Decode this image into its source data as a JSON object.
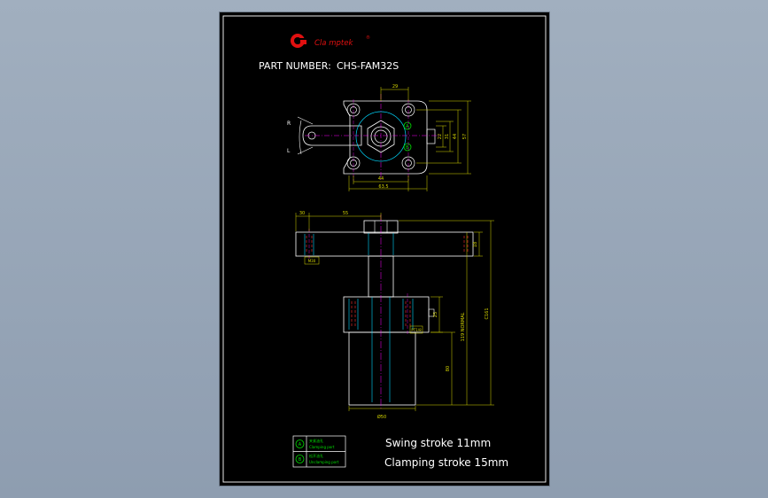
{
  "brand": {
    "name": "Cla mptek",
    "reg_mark": "®",
    "logo_color": "#e01010"
  },
  "drawing": {
    "part_number_label": "PART NUMBER:",
    "part_number": "CHS-FAM32S",
    "swing_stroke": "Swing stroke 11mm",
    "clamping_stroke": "Clamping stroke 15mm"
  },
  "labels": {
    "rotation_right": "R",
    "rotation_left": "L",
    "port_a": "A",
    "port_b": "B"
  },
  "dimensions": {
    "top_width": "29",
    "bolt_spacing_44": "44",
    "overall_width": "63.5",
    "side_22": "22",
    "side_31": "31",
    "side_44": "44",
    "side_57": "57",
    "arm_offset": "30",
    "arm_length": "55",
    "arm_thickness": "18",
    "bolt_hole": "M30",
    "body_flange": "25",
    "port_size": "PT1/8",
    "clamp_height": "119 NORMAL",
    "overall_height": "C161",
    "body_length": "80",
    "body_diameter": "Ø50"
  },
  "legend": {
    "items": [
      {
        "symbol": "A",
        "title": "夹紧油孔",
        "desc": "Clamping port"
      },
      {
        "symbol": "B",
        "title": "松开油孔",
        "desc": "Unclamping port"
      }
    ]
  },
  "colors": {
    "background": "#9aa9ba",
    "sheet": "#000000",
    "geometry": "#ffffff",
    "dimension": "#d6d600",
    "centerline": "#ff00ff",
    "section": "#00d8ff",
    "port": "#00e000",
    "hidden": "#ff3030"
  }
}
